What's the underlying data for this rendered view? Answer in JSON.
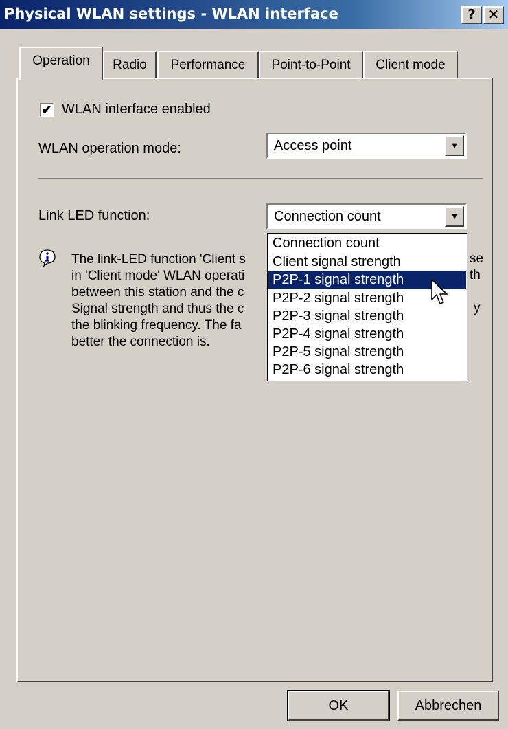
{
  "window": {
    "title": "Physical WLAN settings - WLAN interface",
    "help_label": "?",
    "close_label": "✕"
  },
  "tabs": [
    {
      "label": "Operation",
      "active": true
    },
    {
      "label": "Radio"
    },
    {
      "label": "Performance"
    },
    {
      "label": "Point-to-Point"
    },
    {
      "label": "Client mode"
    }
  ],
  "operation": {
    "wlan_enabled_label": "WLAN interface enabled",
    "wlan_enabled_checked": true,
    "check_mark": "✔",
    "mode_label": "WLAN operation mode:",
    "mode_value": "Access point",
    "link_led_label": "Link LED function:",
    "link_led_value": "Connection count",
    "dropdown_arrow": "▼"
  },
  "info": {
    "lines": [
      "The link-LED function 'Client s",
      "in 'Client mode' WLAN operati",
      "between this station and the c",
      "Signal strength and thus the c",
      "the blinking frequency. The fa",
      "better the connection is."
    ],
    "right_fragments": [
      "se",
      "th",
      "",
      "y",
      "",
      ""
    ]
  },
  "dropdown": {
    "options": [
      "Connection count",
      "Client signal strength",
      "P2P-1 signal strength",
      "P2P-2 signal strength",
      "P2P-3 signal strength",
      "P2P-4 signal strength",
      "P2P-5 signal strength",
      "P2P-6 signal strength"
    ],
    "highlighted_index": 2
  },
  "buttons": {
    "ok": "OK",
    "cancel": "Abbrechen"
  }
}
